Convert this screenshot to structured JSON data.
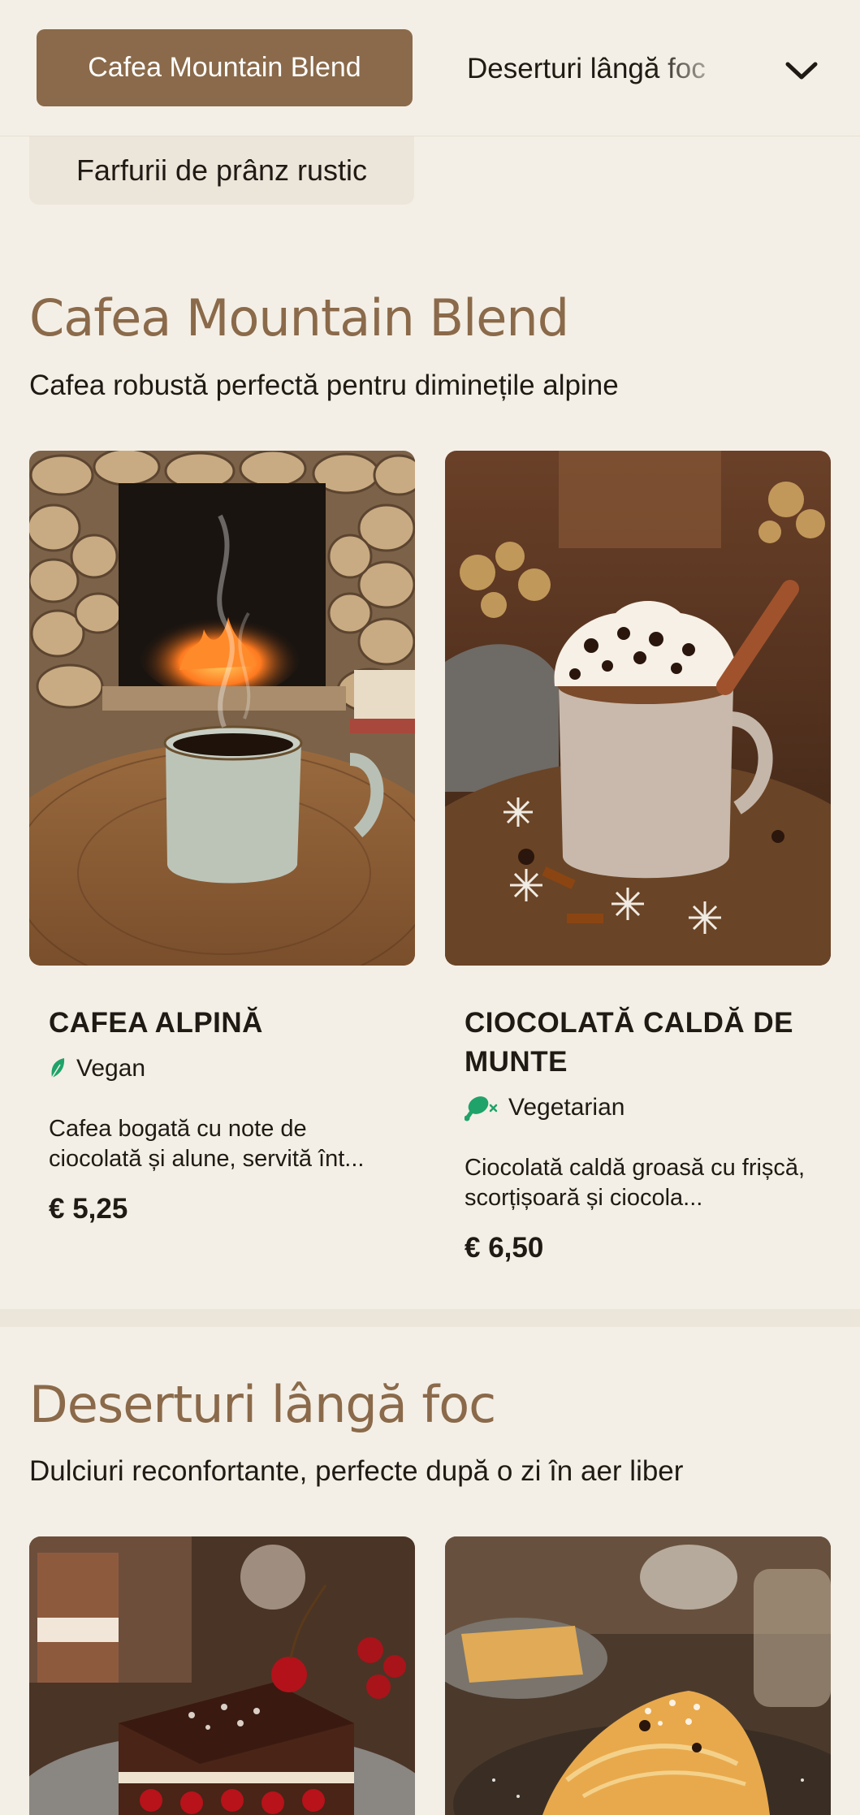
{
  "nav": {
    "active_tab": "Cafea Mountain Blend",
    "next_tab": "Deserturi lângă foc",
    "row2_tab": "Farfurii de prânz rustic",
    "chevron_icon": "chevron-down-icon"
  },
  "sections": [
    {
      "title": "Cafea Mountain Blend",
      "subtitle": "Cafea robustă perfectă pentru diminețile alpine",
      "items": [
        {
          "name": "CAFEA ALPINĂ",
          "tag": "Vegan",
          "tag_icon": "leaf-icon",
          "description": "Cafea bogată cu note de ciocolată și alune, servită înt...",
          "price": "€ 5,25"
        },
        {
          "name": "CIOCOLATĂ CALDĂ DE MUNTE",
          "tag": "Vegetarian",
          "tag_icon": "vegetarian-drumstick-icon",
          "description": "Ciocolată caldă groasă cu frișcă, scorțișoară și ciocola...",
          "price": "€ 6,50"
        }
      ]
    },
    {
      "title": "Deserturi lângă foc",
      "subtitle": "Dulciuri reconfortante, perfecte după o zi în aer liber"
    }
  ],
  "colors": {
    "accent": "#8a6a4a",
    "background": "#f4efe6",
    "tag_green": "#1fa36a"
  }
}
